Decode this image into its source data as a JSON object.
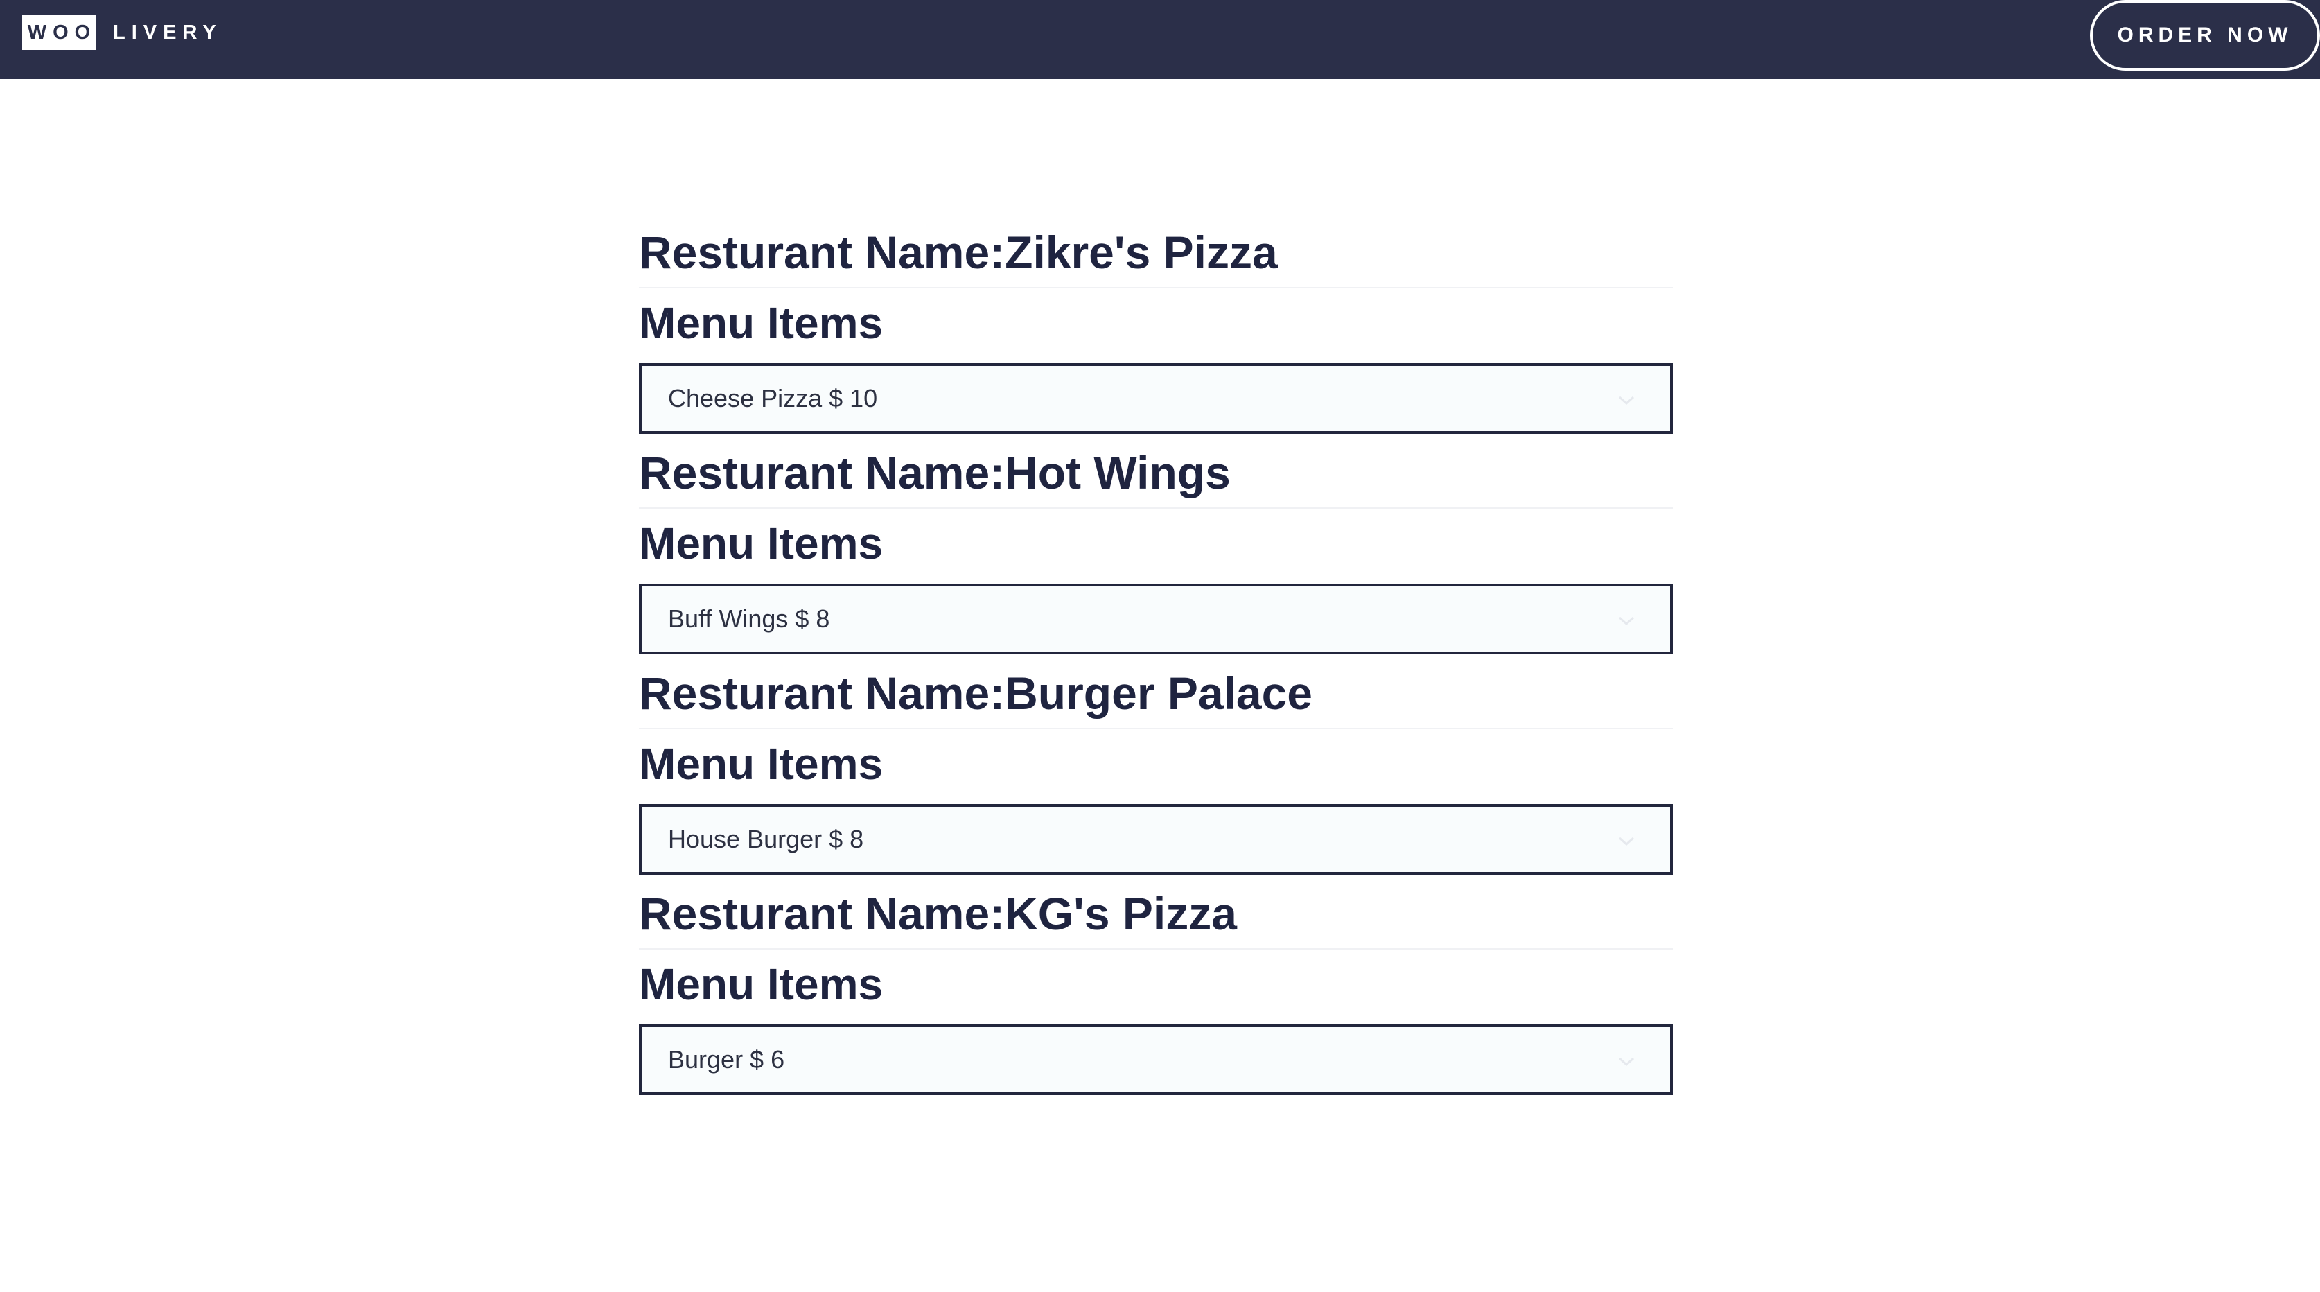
{
  "header": {
    "logo_box": "WOO",
    "logo_text": "LIVERY",
    "order_button": "ORDER NOW"
  },
  "restaurants": [
    {
      "name": "Resturant Name:Zikre's Pizza",
      "menu_title": "Menu Items",
      "selected_item": "Cheese Pizza $ 10"
    },
    {
      "name": "Resturant Name:Hot Wings",
      "menu_title": "Menu Items",
      "selected_item": "Buff Wings $ 8"
    },
    {
      "name": "Resturant Name:Burger Palace",
      "menu_title": "Menu Items",
      "selected_item": "House Burger $ 8"
    },
    {
      "name": "Resturant Name:KG's Pizza",
      "menu_title": "Menu Items",
      "selected_item": "Burger $ 6"
    }
  ],
  "colors": {
    "header_bg": "#2b2f49",
    "text_dark": "#1f2440",
    "select_border": "#22263d",
    "select_bg": "#f9fcfd"
  },
  "icons": {
    "dropdown": "chevron-down-icon"
  }
}
